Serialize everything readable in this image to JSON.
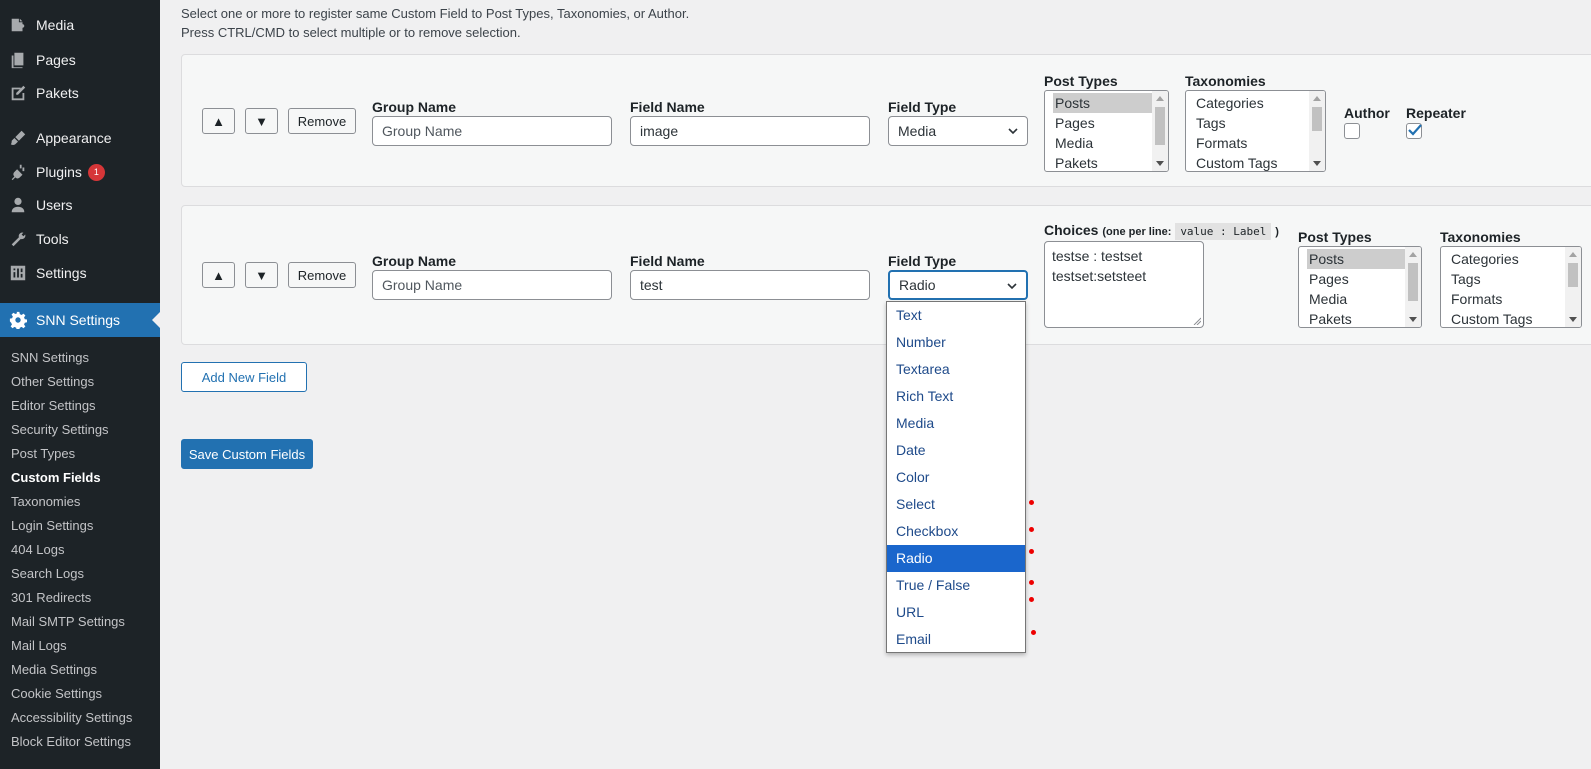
{
  "sidebar": {
    "top_items": [
      {
        "label": "Media",
        "icon": "media-icon"
      },
      {
        "label": "Pages",
        "icon": "pages-icon"
      },
      {
        "label": "Pakets",
        "icon": "pakets-icon"
      },
      {
        "label": "Appearance",
        "icon": "appearance-icon"
      },
      {
        "label": "Plugins",
        "icon": "plugins-icon",
        "badge": "1"
      },
      {
        "label": "Users",
        "icon": "users-icon"
      },
      {
        "label": "Tools",
        "icon": "tools-icon"
      },
      {
        "label": "Settings",
        "icon": "settings-icon"
      },
      {
        "label": "SNN Settings",
        "icon": "gear-icon",
        "current": true
      }
    ],
    "submenu": [
      "SNN Settings",
      "Other Settings",
      "Editor Settings",
      "Security Settings",
      "Post Types",
      "Custom Fields",
      "Taxonomies",
      "Login Settings",
      "404 Logs",
      "Search Logs",
      "301 Redirects",
      "Mail SMTP Settings",
      "Mail Logs",
      "Media Settings",
      "Cookie Settings",
      "Accessibility Settings",
      "Block Editor Settings"
    ],
    "active_submenu": "Custom Fields"
  },
  "description": {
    "line1": "Select one or more to register same Custom Field to Post Types, Taxonomies, or Author.",
    "line2": "Press CTRL/CMD to select multiple or to remove selection."
  },
  "labels": {
    "up": "▲",
    "down": "▼",
    "remove": "Remove",
    "group_name": "Group Name",
    "field_name": "Field Name",
    "field_type": "Field Type",
    "post_types": "Post Types",
    "taxonomies": "Taxonomies",
    "author": "Author",
    "repeater": "Repeater",
    "choices": "Choices",
    "choices_hint_pre": "(one per line:",
    "choices_hint_code": "value : Label",
    "choices_hint_post": ")"
  },
  "row1": {
    "group_name_placeholder": "Group Name",
    "field_name": "image",
    "field_type": "Media",
    "post_types": [
      "Posts",
      "Pages",
      "Media",
      "Pakets"
    ],
    "taxonomies": [
      "Categories",
      "Tags",
      "Formats",
      "Custom Tags"
    ],
    "author_checked": false,
    "repeater_checked": true
  },
  "row2": {
    "group_name_placeholder": "Group Name",
    "field_name": "test",
    "field_type": "Radio",
    "choices": [
      "testse : testset",
      "testset:setsteet"
    ],
    "post_types": [
      "Posts",
      "Pages",
      "Media",
      "Pakets"
    ],
    "taxonomies": [
      "Categories",
      "Tags",
      "Formats",
      "Custom Tags"
    ]
  },
  "dropdown_options": [
    "Text",
    "Number",
    "Textarea",
    "Rich Text",
    "Media",
    "Date",
    "Color",
    "Select",
    "Checkbox",
    "Radio",
    "True / False",
    "URL",
    "Email"
  ],
  "dropdown_highlighted": "Radio",
  "buttons": {
    "add_new_field": "Add New Field",
    "save": "Save Custom Fields"
  },
  "colors": {
    "admin_bar": "#1d2327",
    "accent": "#2271b1",
    "badge": "#d63638",
    "highlight": "#1a66cc"
  }
}
